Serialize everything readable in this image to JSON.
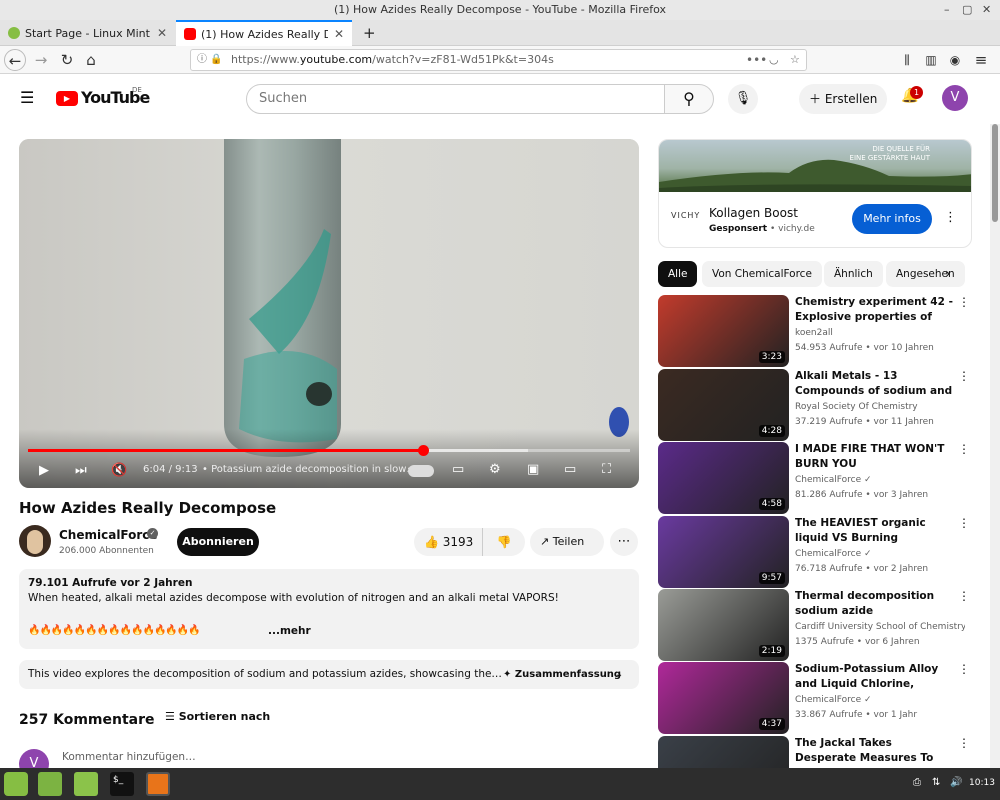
{
  "window_title": "(1) How Azides Really Decompose - YouTube - Mozilla Firefox",
  "tabs": [
    {
      "label": "Start Page - Linux Mint",
      "active": false
    },
    {
      "label": "(1) How Azides Really Decompose",
      "active": true
    }
  ],
  "nav": {
    "url_prefix": "https://www.",
    "url_host": "youtube.com",
    "url_path": "/watch?v=zF81-Wd51Pk&t=304s"
  },
  "youtube": {
    "logo_text": "YouTube",
    "region": "DE",
    "search_placeholder": "Suchen",
    "create_label": "Erstellen",
    "notification_count": "1",
    "avatar_letter": "V"
  },
  "player": {
    "time": "6:04 / 9:13",
    "chapter": "• Potassium azide decomposition in slow…",
    "progress_fraction": 0.656,
    "buffered_fraction": 0.83
  },
  "video": {
    "title": "How Azides Really Decompose",
    "channel": "ChemicalForce",
    "subscribers": "206.000 Abonnenten",
    "subscribe_label": "Abonnieren",
    "likes": "3193",
    "share_label": "Teilen",
    "views_age": "79.101 Aufrufe  vor 2 Jahren",
    "description": "When heated, alkali metal azides decompose with evolution of nitrogen and an alkali metal VAPORS!",
    "emoji_row": "🔥🔥🔥🔥🔥🔥🔥🔥🔥🔥🔥🔥🔥🔥🔥",
    "more_label": "...mehr",
    "summary_text": "This video explores the decomposition of sodium and potassium azides, showcasing the…",
    "summary_label": "Zusammenfassung",
    "comments_count": "257 Kommentare",
    "sort_label": "Sortieren nach",
    "comment_placeholder": "Kommentar hinzufügen…"
  },
  "ad": {
    "slogan_line1": "DIE QUELLE FÜR",
    "slogan_line2": "EINE GESTÄRKTE HAUT",
    "logo": "VICHY",
    "title": "Kollagen Boost",
    "sponsor": "Gesponsert",
    "domain": " • vichy.de",
    "button": "Mehr infos"
  },
  "chips": [
    "Alle",
    "Von ChemicalForce",
    "Ähnlich",
    "Angesehen"
  ],
  "recommendations": [
    {
      "title": "Chemistry experiment 42 - Explosive properties of azides",
      "channel": "koen2all",
      "views": "54.953 Aufrufe",
      "age": "vor 10 Jahren",
      "duration": "3:23",
      "verified": false,
      "thumb": "#c23b2c"
    },
    {
      "title": "Alkali Metals - 13 Compounds of sodium and nitrogen - Periodic...",
      "channel": "Royal Society Of Chemistry",
      "views": "37.219 Aufrufe",
      "age": "vor 11 Jahren",
      "duration": "4:28",
      "verified": false,
      "thumb": "#3b2a22"
    },
    {
      "title": "I MADE FIRE THAT WON'T BURN YOU",
      "channel": "ChemicalForce",
      "views": "81.286 Aufrufe",
      "age": "vor 3 Jahren",
      "duration": "4:58",
      "verified": true,
      "thumb": "#5b2a8a"
    },
    {
      "title": "The HEAVIEST organic liquid VS Burning Magnesium!",
      "channel": "ChemicalForce",
      "views": "76.718 Aufrufe",
      "age": "vor 2 Jahren",
      "duration": "9:57",
      "verified": true,
      "thumb": "#6a3aa0"
    },
    {
      "title": "Thermal decomposition sodium azide",
      "channel": "Cardiff University School of Chemistry",
      "views": "1375 Aufrufe",
      "age": "vor 6 Jahren",
      "duration": "2:19",
      "verified": false,
      "thumb": "#9a9c97"
    },
    {
      "title": "Sodium-Potassium Alloy and Liquid Chlorine, Bromine, Iodine...",
      "channel": "ChemicalForce",
      "views": "33.867 Aufrufe",
      "age": "vor 1 Jahr",
      "duration": "4:37",
      "verified": true,
      "thumb": "#b0289a"
    },
    {
      "title": "The Jackal Takes Desperate Measures To Avoid Capture | The...",
      "channel": "",
      "views": "",
      "age": "",
      "duration": "",
      "verified": false,
      "thumb": "#3a4048"
    }
  ],
  "taskbar": {
    "clock": "10:13"
  }
}
